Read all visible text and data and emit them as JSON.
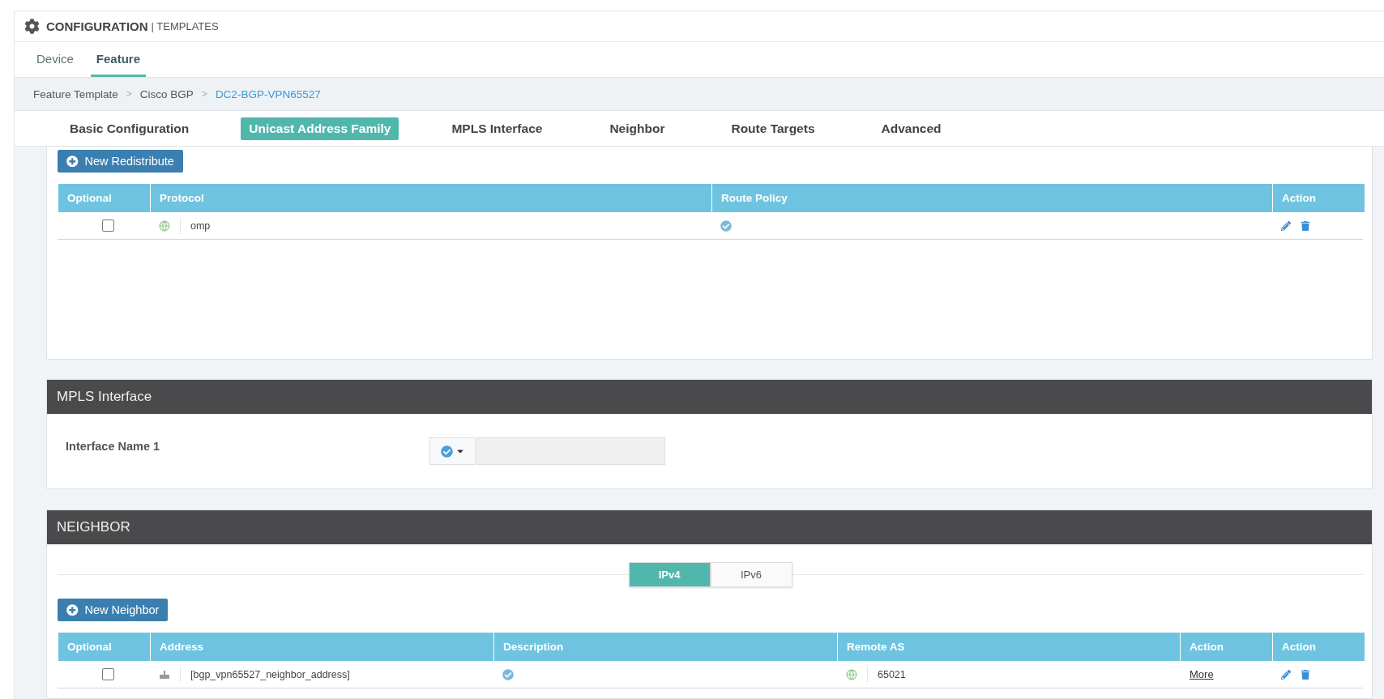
{
  "header": {
    "title": "CONFIGURATION",
    "subtitle": "| TEMPLATES"
  },
  "tabs": [
    {
      "label": "Device",
      "selected": false
    },
    {
      "label": "Feature",
      "selected": true
    }
  ],
  "breadcrumb": {
    "items": [
      {
        "label": "Feature Template",
        "current": false
      },
      {
        "label": "Cisco BGP",
        "current": false
      },
      {
        "label": "DC2-BGP-VPN65527",
        "current": true
      }
    ],
    "separators": [
      ">",
      ">"
    ]
  },
  "section_tabs": [
    {
      "label": "Basic Configuration",
      "selected": false
    },
    {
      "label": "Unicast Address Family",
      "selected": true
    },
    {
      "label": "MPLS Interface",
      "selected": false
    },
    {
      "label": "Neighbor",
      "selected": false
    },
    {
      "label": "Route Targets",
      "selected": false
    },
    {
      "label": "Advanced",
      "selected": false
    }
  ],
  "redistribute": {
    "button": "New Redistribute",
    "columns": [
      "Optional",
      "Protocol",
      "Route Policy",
      "Action"
    ],
    "rows": [
      {
        "checked": false,
        "protocol": "omp"
      }
    ]
  },
  "mpls": {
    "title": "MPLS Interface",
    "fields": [
      {
        "label": "Interface Name 1"
      }
    ]
  },
  "neighbor": {
    "title": "NEIGHBOR",
    "ip_toggle": [
      {
        "label": "IPv4",
        "selected": true
      },
      {
        "label": "IPv6",
        "selected": false
      }
    ],
    "button": "New Neighbor",
    "columns": [
      "Optional",
      "Address",
      "Description",
      "Remote AS",
      "Action",
      "Action"
    ],
    "rows": [
      {
        "checked": false,
        "address": "[bgp_vpn65527_neighbor_address]",
        "remote_as": "65021",
        "more": "More"
      }
    ]
  }
}
